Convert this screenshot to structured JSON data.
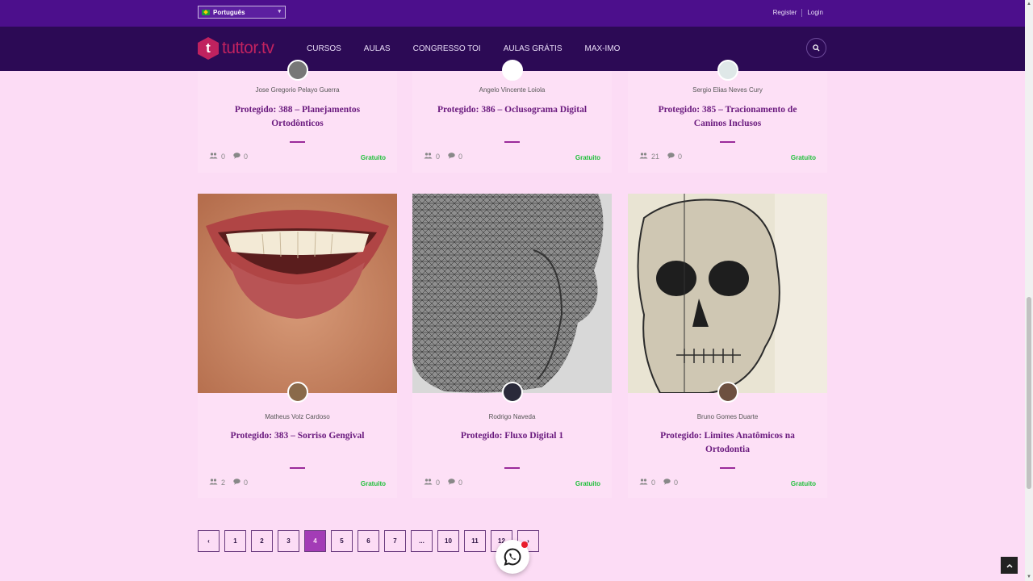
{
  "topbar": {
    "language": "Português",
    "register": "Register",
    "login": "Login"
  },
  "nav": {
    "logo_mark": "t",
    "logo_text": "tuttor.tv",
    "menu": [
      "CURSOS",
      "AULAS",
      "CONGRESSO TOI",
      "AULAS GRÁTIS",
      "MAX-IMO"
    ]
  },
  "cards_top": [
    {
      "author": "Jose Gregorio Pelayo Guerra",
      "title": "Protegido: 388 – Planejamentos Ortodônticos",
      "students": "0",
      "comments": "0",
      "price": "Gratuito"
    },
    {
      "author": "Angelo Vincente Loiola",
      "title": "Protegido: 386 – Oclusograma Digital",
      "students": "0",
      "comments": "0",
      "price": "Gratuito"
    },
    {
      "author": "Sergio Elias Neves Cury",
      "title": "Protegido: 385 – Tracionamento de Caninos Inclusos",
      "students": "21",
      "comments": "0",
      "price": "Gratuito"
    }
  ],
  "cards_bottom": [
    {
      "author": "Matheus Volz Cardoso",
      "title": "Protegido: 383 – Sorriso Gengival",
      "students": "2",
      "comments": "0",
      "price": "Gratuito"
    },
    {
      "author": "Rodrigo Naveda",
      "title": "Protegido: Fluxo Digital 1",
      "students": "0",
      "comments": "0",
      "price": "Gratuito"
    },
    {
      "author": "Bruno Gomes Duarte",
      "title": "Protegido: Limites Anatômicos na Ortodontia",
      "students": "0",
      "comments": "0",
      "price": "Gratuito"
    }
  ],
  "pagination": {
    "prev": "‹",
    "pages": [
      "1",
      "2",
      "3",
      "4",
      "5",
      "6",
      "7",
      "...",
      "10",
      "11",
      "12"
    ],
    "current": "4",
    "next": "›"
  },
  "colors": {
    "background": "#fcdcf5",
    "topbar": "#4c0f8c",
    "nav": "#2c0a55",
    "brand": "#c0225f",
    "title": "#6a1a7e",
    "price": "#1fbf3a",
    "active_page": "#a33cb6"
  }
}
